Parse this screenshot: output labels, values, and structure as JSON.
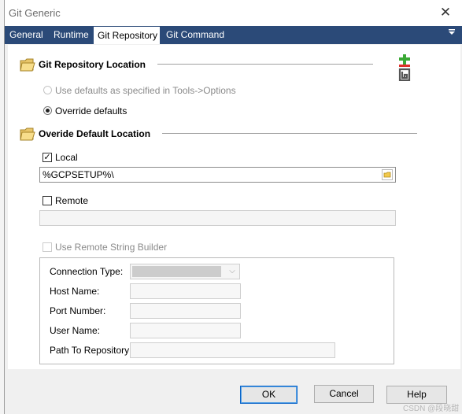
{
  "window": {
    "title": "Git Generic",
    "close_glyph": "✕"
  },
  "tabs": [
    {
      "label": "General",
      "active": false
    },
    {
      "label": "Runtime",
      "active": false
    },
    {
      "label": "Git Repository",
      "active": true
    },
    {
      "label": "Git Command",
      "active": false
    }
  ],
  "tab_menu_icon": "dropdown-menu-icon",
  "repo_location": {
    "title": "Git Repository Location",
    "options": [
      {
        "label": "Use defaults as specified in Tools->Options",
        "checked": false,
        "enabled": false
      },
      {
        "label": "Override defaults",
        "checked": true,
        "enabled": true
      }
    ]
  },
  "default_location": {
    "title": "Overide Default Location",
    "local_label": "Local",
    "local_checked": true,
    "local_path": "%GCPSETUP%\\",
    "remote_label": "Remote",
    "remote_checked": false,
    "remote_path": "",
    "builder_label": "Use Remote String Builder",
    "builder_checked": false
  },
  "connection": {
    "type_label": "Connection Type:",
    "host_label": "Host Name:",
    "port_label": "Port Number:",
    "user_label": "User Name:",
    "path_label": "Path To Repository:"
  },
  "buttons": {
    "ok": "OK",
    "cancel": "Cancel",
    "help": "Help"
  },
  "watermark": "CSDN @段晓甜",
  "colors": {
    "tabbar": "#2b4a78",
    "accent": "#0a64c8",
    "git_green": "#3aa935",
    "git_red": "#e0302a"
  }
}
